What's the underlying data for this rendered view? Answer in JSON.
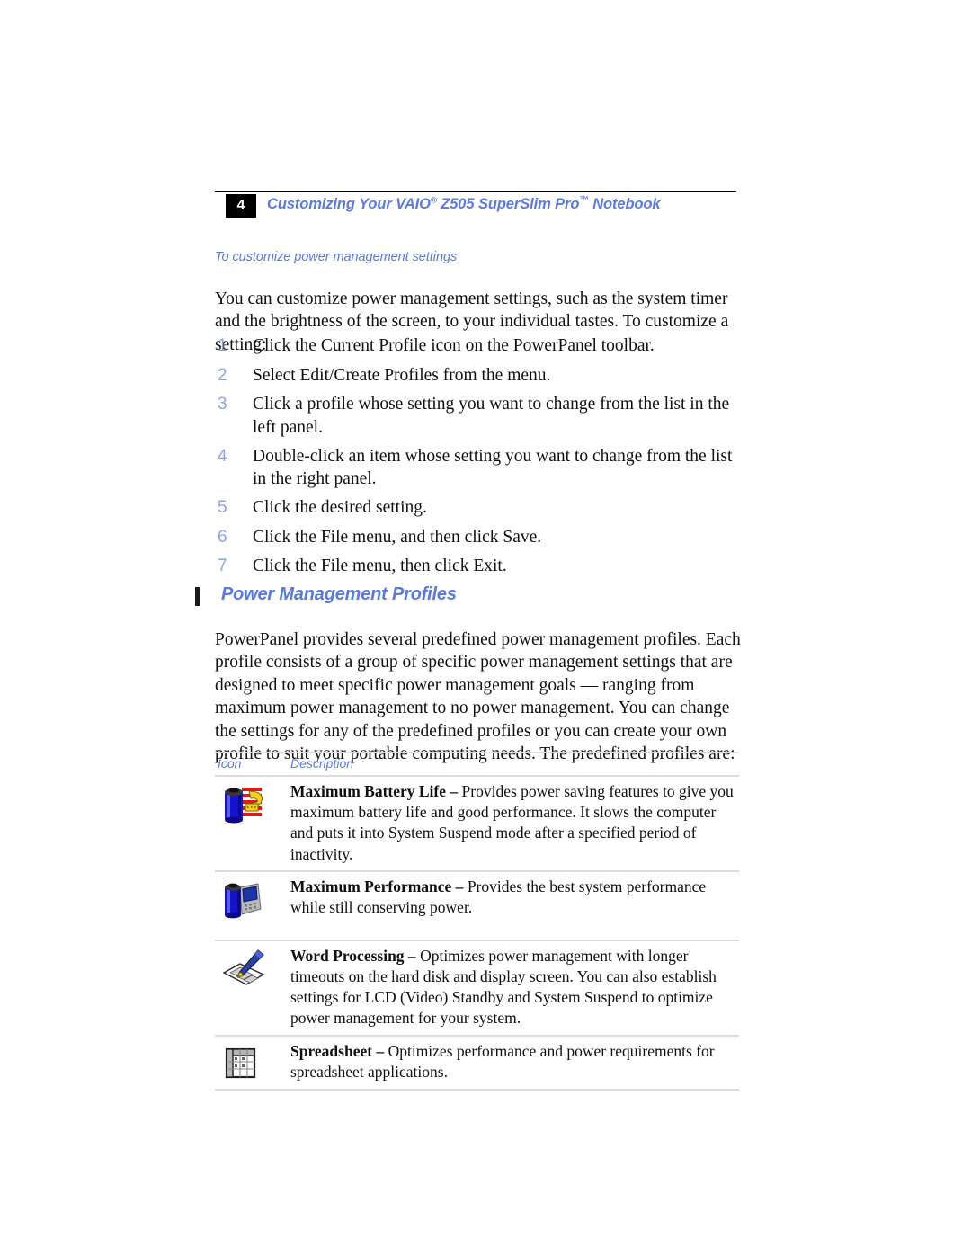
{
  "header": {
    "page_number": "4",
    "title_prefix": "Customizing Your VAIO",
    "title_reg": "®",
    "title_mid": " Z505 SuperSlim Pro",
    "title_tm": "™",
    "title_suffix": " Notebook"
  },
  "sub_heading": "To customize power management settings",
  "intro_paragraph": "You can customize power management settings, such as the system timer and the brightness of the screen, to your individual tastes. To customize a setting:",
  "steps": [
    {
      "num": "1",
      "text": "Click the Current Profile icon on the PowerPanel toolbar."
    },
    {
      "num": "2",
      "text": "Select Edit/Create Profiles from the menu."
    },
    {
      "num": "3",
      "text": "Click a profile whose setting you want to change from the list in the left panel."
    },
    {
      "num": "4",
      "text": "Double-click an item whose setting you want to change from the list in the right panel."
    },
    {
      "num": "5",
      "text": "Click the desired setting."
    },
    {
      "num": "6",
      "text": "Click the File menu, and then click Save."
    },
    {
      "num": "7",
      "text": "Click the File menu, then click Exit."
    }
  ],
  "section": {
    "heading": "Power Management Profiles",
    "paragraph": "PowerPanel provides several predefined power management profiles. Each profile consists of a group of specific power management settings that are designed to meet specific power management goals — ranging from maximum power management to no power management. You can change the settings for any of the predefined profiles or you can create your own profile to suit your portable computing needs. The predefined profiles are:"
  },
  "table": {
    "columns": {
      "icon": "Icon",
      "description": "Description"
    },
    "rows": [
      {
        "icon_name": "battery-measuring-tape-icon",
        "term": "Maximum Battery Life – ",
        "text": "Provides power saving features to give you maximum battery life and good performance. It slows the computer and puts it into System Suspend mode after a specified period of inactivity."
      },
      {
        "icon_name": "battery-performance-gauge-icon",
        "term": "Maximum Performance – ",
        "text": "Provides the best system performance while still conserving power."
      },
      {
        "icon_name": "pen-writing-document-icon",
        "term": "Word Processing – ",
        "text": "Optimizes power management with longer timeouts on the hard disk and display screen. You can also establish settings for LCD (Video) Standby and System Suspend to optimize power management for your system."
      },
      {
        "icon_name": "spreadsheet-grid-icon",
        "term": "Spreadsheet – ",
        "text": "Optimizes performance and power requirements for spreadsheet applications."
      }
    ]
  },
  "colors": {
    "accent_blue": "#5a7ae0",
    "step_number_blue": "#8fa4e8",
    "rule_gray": "#dcdcdc",
    "page_box_black": "#000000"
  }
}
